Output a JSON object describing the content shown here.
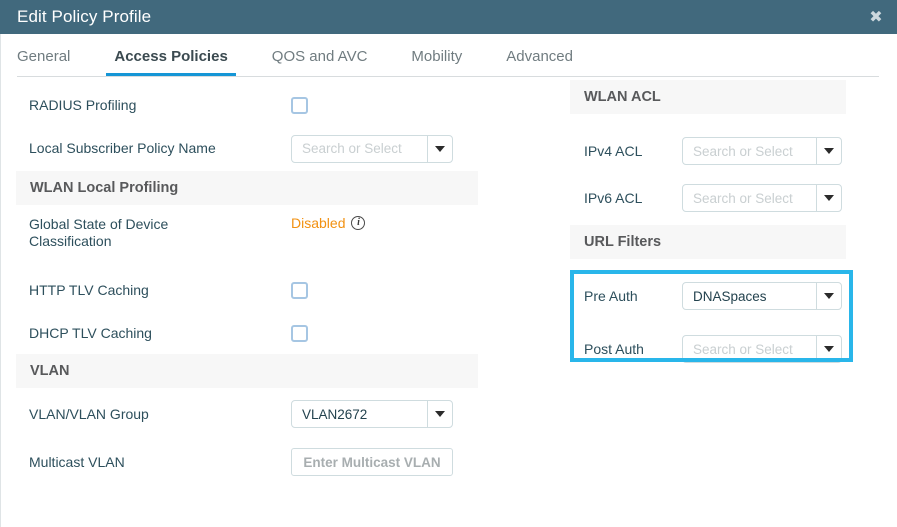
{
  "window": {
    "title": "Edit Policy Profile",
    "close_label": "✖"
  },
  "tabs": [
    {
      "label": "General",
      "active": false
    },
    {
      "label": "Access Policies",
      "active": true
    },
    {
      "label": "QOS and AVC",
      "active": false
    },
    {
      "label": "Mobility",
      "active": false
    },
    {
      "label": "Advanced",
      "active": false
    }
  ],
  "left_column": {
    "radius_profiling": {
      "label": "RADIUS Profiling",
      "checked": false
    },
    "local_subscriber_policy": {
      "label": "Local Subscriber Policy Name",
      "value": "",
      "placeholder": "Search or Select"
    },
    "wlan_local_profiling": {
      "section_title": "WLAN Local Profiling",
      "global_state": {
        "label": "Global State of Device Classification",
        "label_line1": "Global State of Device",
        "label_line2": "Classification",
        "value": "Disabled",
        "info_glyph": "i"
      },
      "http_tlv_caching": {
        "label": "HTTP TLV Caching",
        "checked": false
      },
      "dhcp_tlv_caching": {
        "label": "DHCP TLV Caching",
        "checked": false
      }
    },
    "vlan": {
      "section_title": "VLAN",
      "vlan_group": {
        "label": "VLAN/VLAN Group",
        "value": "VLAN2672",
        "placeholder": "Search or Select"
      },
      "multicast_vlan": {
        "label": "Multicast VLAN",
        "value": "",
        "placeholder": "Enter Multicast VLAN"
      }
    }
  },
  "right_column": {
    "wlan_acl": {
      "section_title": "WLAN ACL",
      "ipv4_acl": {
        "label": "IPv4 ACL",
        "value": "",
        "placeholder": "Search or Select"
      },
      "ipv6_acl": {
        "label": "IPv6 ACL",
        "value": "",
        "placeholder": "Search or Select"
      }
    },
    "url_filters": {
      "section_title": "URL Filters",
      "pre_auth": {
        "label": "Pre Auth",
        "value": "DNASpaces",
        "placeholder": "Search or Select"
      },
      "post_auth": {
        "label": "Post Auth",
        "value": "",
        "placeholder": "Search or Select"
      }
    }
  },
  "colors": {
    "titlebar": "#41697d",
    "active_tab_underline": "#1596d6",
    "highlight_border": "#29b6ea",
    "status_warning": "#f29111",
    "label": "#2d4f5c",
    "section_header_bg": "#f7f7f7"
  }
}
